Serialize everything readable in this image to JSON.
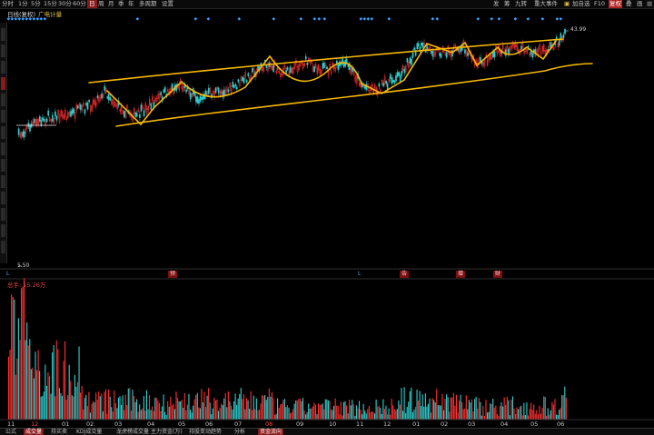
{
  "top_menu": [
    {
      "label": "分时"
    },
    {
      "label": "1分"
    },
    {
      "label": "5分"
    },
    {
      "label": "15分"
    },
    {
      "label": "30分"
    },
    {
      "label": "60分"
    },
    {
      "label": "日"
    },
    {
      "label": "周"
    },
    {
      "label": "月"
    },
    {
      "label": "季"
    },
    {
      "label": "年"
    },
    {
      "label": "多周期"
    },
    {
      "label": "设置"
    }
  ],
  "active_period": "日",
  "right_menu": [
    {
      "label": "发"
    },
    {
      "label": "筹"
    },
    {
      "label": "九转"
    },
    {
      "label": "重大事件"
    },
    {
      "label": "加自选"
    },
    {
      "label": "F10"
    },
    {
      "label": "复权"
    },
    {
      "label": "叠"
    },
    {
      "label": "画"
    }
  ],
  "chart_title": "日线(复权)",
  "indicator_name": "广电计量",
  "max_price_label": "43.99",
  "min_price_label": "5.50",
  "event_markers": [
    {
      "label": "L"
    },
    {
      "label": "预"
    },
    {
      "label": "L"
    },
    {
      "label": "告"
    },
    {
      "label": "增"
    },
    {
      "label": "财"
    }
  ],
  "volume_title": "总手: 15.26万",
  "month_axis": [
    {
      "label": "11"
    },
    {
      "label": "12"
    },
    {
      "label": "01"
    },
    {
      "label": "02"
    },
    {
      "label": "03"
    },
    {
      "label": "04"
    },
    {
      "label": "05"
    },
    {
      "label": "06"
    },
    {
      "label": "07"
    },
    {
      "label": "08"
    },
    {
      "label": "09"
    },
    {
      "label": "10"
    },
    {
      "label": "11"
    },
    {
      "label": "12"
    },
    {
      "label": "01"
    },
    {
      "label": "02"
    },
    {
      "label": "03"
    },
    {
      "label": "04"
    },
    {
      "label": "05"
    },
    {
      "label": "06"
    }
  ],
  "bottom_tabs": [
    {
      "label": "公式"
    },
    {
      "label": "成交量"
    },
    {
      "label": "持买卖"
    },
    {
      "label": "KDJ成交量"
    },
    {
      "label": "龙虎榜成交量"
    },
    {
      "label": "主力资金(万)"
    },
    {
      "label": "持股变动趋势"
    },
    {
      "label": "分析"
    },
    {
      "label": "资金流向"
    }
  ],
  "colors": {
    "up": "#ff3030",
    "down": "#30d0d0",
    "trend_lines": "#f5b800",
    "accent_red": "#b02020"
  }
}
